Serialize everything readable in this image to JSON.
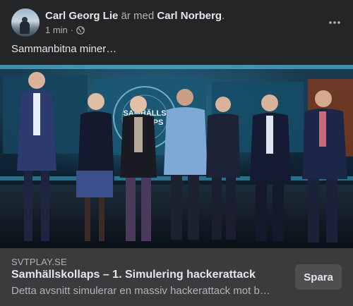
{
  "post": {
    "author": "Carl Georg Lie",
    "with_text": "är med",
    "tagged": "Carl Norberg",
    "period": ".",
    "time": "1 min",
    "dot": "·",
    "privacy_icon": "globe-icon",
    "caption": "Sammanbitna miner…"
  },
  "link": {
    "domain": "SVTPLAY.SE",
    "title": "Samhällskollaps – 1. Simulering hackerattack",
    "description": "Detta avsnitt simulerar en massiv hackerattack mot b…",
    "save_label": "Spara"
  },
  "media": {
    "screen_text_line1": "SAMHÄLLS",
    "screen_text_line2": "KOLLAPS"
  },
  "colors": {
    "background": "#242526",
    "footer": "#3a3b3c",
    "button": "#4e4f50",
    "text_primary": "#e4e6eb",
    "text_secondary": "#b0b3b8"
  }
}
